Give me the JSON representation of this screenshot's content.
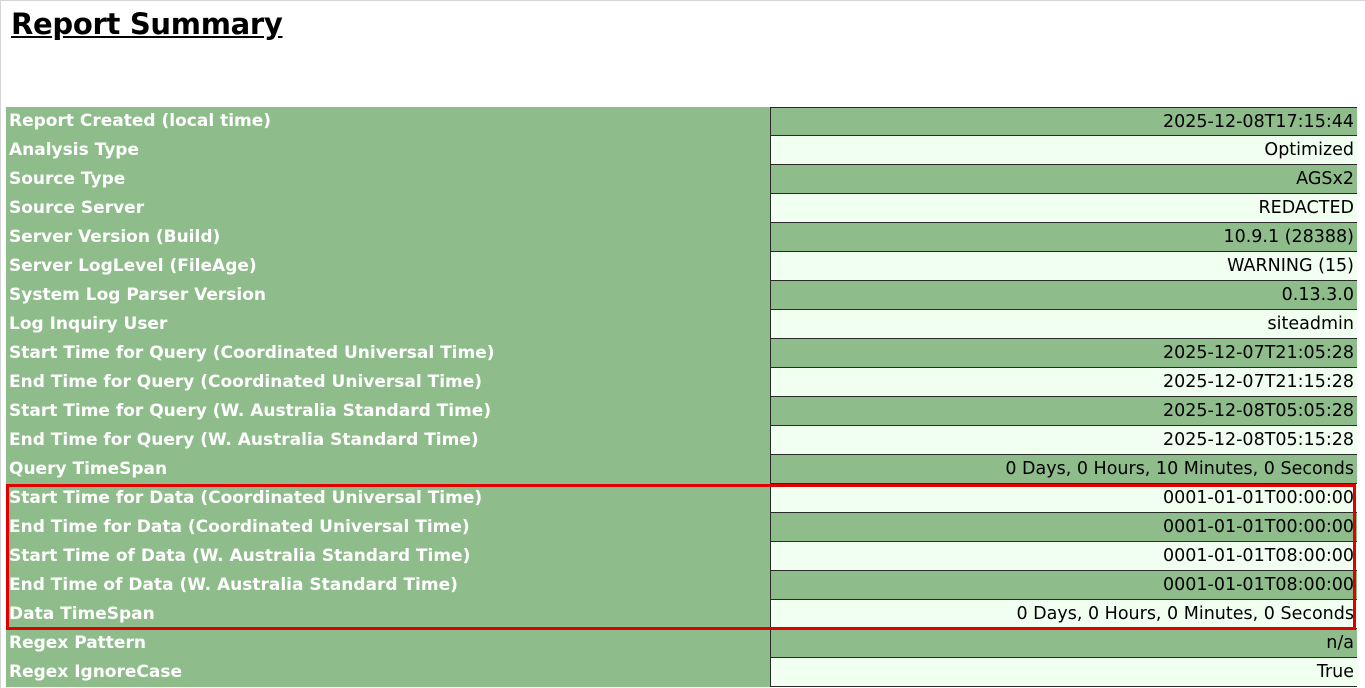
{
  "title": "Report Summary",
  "rows": [
    {
      "label": "Report Created (local time)",
      "value": "2025-12-08T17:15:44"
    },
    {
      "label": "Analysis Type",
      "value": "Optimized"
    },
    {
      "label": "Source Type",
      "value": "AGSx2"
    },
    {
      "label": "Source Server",
      "value": "REDACTED"
    },
    {
      "label": "Server Version (Build)",
      "value": "10.9.1 (28388)"
    },
    {
      "label": "Server LogLevel (FileAge)",
      "value": "WARNING (15)"
    },
    {
      "label": "System Log Parser Version",
      "value": "0.13.3.0"
    },
    {
      "label": "Log Inquiry User",
      "value": "siteadmin"
    },
    {
      "label": "Start Time for Query (Coordinated Universal Time)",
      "value": "2025-12-07T21:05:28"
    },
    {
      "label": "End Time for Query (Coordinated Universal Time)",
      "value": "2025-12-07T21:15:28"
    },
    {
      "label": "Start Time for Query (W. Australia Standard Time)",
      "value": "2025-12-08T05:05:28"
    },
    {
      "label": "End Time for Query (W. Australia Standard Time)",
      "value": "2025-12-08T05:15:28"
    },
    {
      "label": "Query TimeSpan",
      "value": "0 Days, 0 Hours, 10 Minutes, 0 Seconds"
    },
    {
      "label": "Start Time for Data (Coordinated Universal Time)",
      "value": "0001-01-01T00:00:00"
    },
    {
      "label": "End Time for Data (Coordinated Universal Time)",
      "value": "0001-01-01T00:00:00"
    },
    {
      "label": "Start Time of Data (W. Australia Standard Time)",
      "value": "0001-01-01T08:00:00"
    },
    {
      "label": "End Time of Data (W. Australia Standard Time)",
      "value": "0001-01-01T08:00:00"
    },
    {
      "label": "Data TimeSpan",
      "value": "0 Days, 0 Hours, 0 Minutes, 0 Seconds"
    },
    {
      "label": "Regex Pattern",
      "value": "n/a"
    },
    {
      "label": "Regex IgnoreCase",
      "value": "True"
    }
  ],
  "colors": {
    "label_bg": "#8fbc8b",
    "value_light_bg": "#f0fff0",
    "highlight_border": "#e00000"
  }
}
